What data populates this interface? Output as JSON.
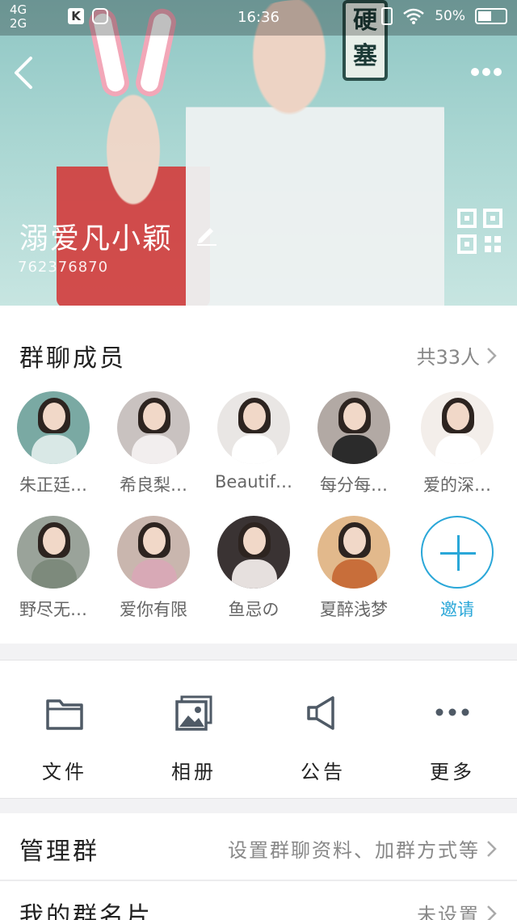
{
  "status_bar": {
    "network_1": "4G",
    "network_2": "2G",
    "time": "16:36",
    "battery": "50%"
  },
  "header": {
    "group_name": "溺爱凡小颖",
    "group_id": "762376870",
    "sign_text": "硬塞"
  },
  "members": {
    "title": "群聊成员",
    "count": "共33人",
    "list": [
      {
        "name": "朱正廷…",
        "bg": "#7aa9a3",
        "body": "#d9e8e6"
      },
      {
        "name": "希良梨…",
        "bg": "#c9c2c0",
        "body": "#f2eeee"
      },
      {
        "name": "Beautif…",
        "bg": "#e9e6e4",
        "body": "#ffffff"
      },
      {
        "name": "每分每…",
        "bg": "#b2a9a4",
        "body": "#2b2b2b"
      },
      {
        "name": "爱的深…",
        "bg": "#f3eeea",
        "body": "#ffffff"
      },
      {
        "name": "野尽无…",
        "bg": "#9aa39a",
        "body": "#7d8a7c"
      },
      {
        "name": "爱你有限",
        "bg": "#c9b6ae",
        "body": "#d8a9b6"
      },
      {
        "name": "鱼忌の",
        "bg": "#3a3333",
        "body": "#e6e0de"
      },
      {
        "name": "夏醉浅梦",
        "bg": "#e2b98c",
        "body": "#c86e3a"
      }
    ],
    "invite_label": "邀请"
  },
  "functions": [
    {
      "label": "文件",
      "icon": "folder-icon"
    },
    {
      "label": "相册",
      "icon": "album-icon"
    },
    {
      "label": "公告",
      "icon": "announcement-icon"
    },
    {
      "label": "更多",
      "icon": "more-dots-icon"
    }
  ],
  "settings": {
    "manage": {
      "title": "管理群",
      "value": "设置群聊资料、加群方式等"
    },
    "card": {
      "title": "我的群名片",
      "value": "未设置"
    }
  },
  "colors": {
    "accent": "#2aa7d8",
    "icon_gray": "#4f5a66"
  }
}
